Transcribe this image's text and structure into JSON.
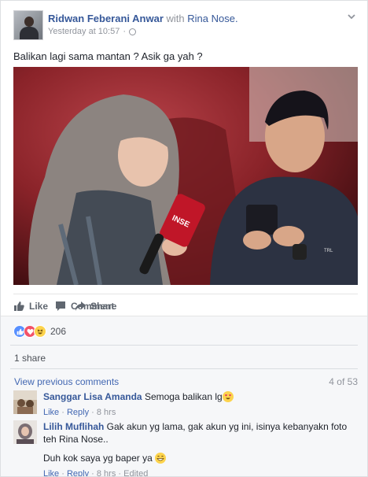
{
  "post": {
    "author": "Ridwan Feberani Anwar",
    "with_label": "with",
    "tagged": "Rina Nose.",
    "timestamp": "Yesterday at 10:57",
    "separator": "·",
    "privacy_icon": "globe-icon",
    "text": "Balikan lagi sama mantan ? Asik ga yah ?"
  },
  "photo": {
    "microphone_text": "INSE"
  },
  "actions": {
    "like": "Like",
    "comment": "Comment",
    "share": "Share"
  },
  "reactions": {
    "count": "206",
    "types": [
      "like",
      "love",
      "haha"
    ]
  },
  "shares": "1 share",
  "comments_section": {
    "view_previous": "View previous comments",
    "count": "4 of 53",
    "items": [
      {
        "name": "Sanggar Lisa Amanda",
        "text": "Semoga balikan lg",
        "emoji": "heart-eyes-emoji",
        "like": "Like",
        "reply": "Reply",
        "time": "8 hrs"
      },
      {
        "name": "Lilih Muflihah",
        "text": "Gak akun yg lama, gak akun yg ini, isinya kebanyakn foto teh Rina Nose..",
        "text2": "Duh kok saya yg baper ya",
        "emoji": "grinning-emoji",
        "like": "Like",
        "reply": "Reply",
        "time": "8 hrs",
        "edited": "Edited"
      }
    ]
  },
  "colors": {
    "link": "#365899",
    "muted": "#90949c",
    "like_blue": "#5890ff",
    "love_red": "#f25268",
    "haha_yellow": "#fcd34d"
  }
}
